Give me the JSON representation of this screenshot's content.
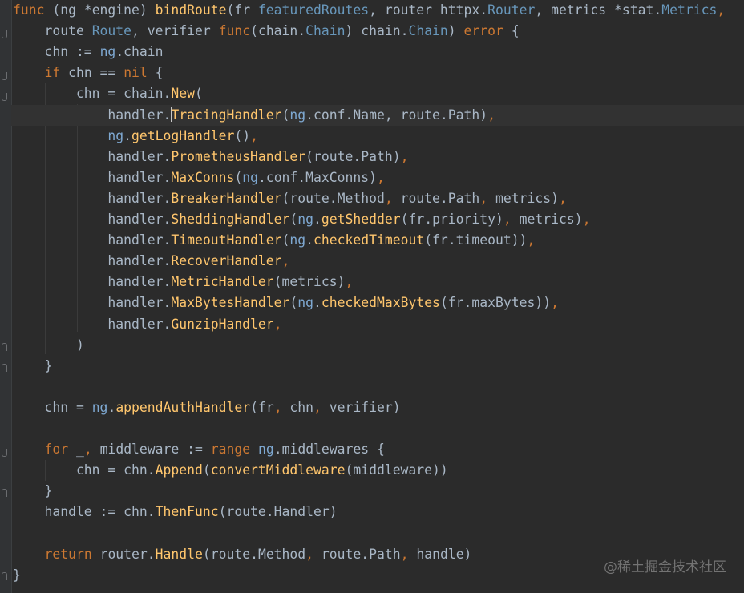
{
  "colors": {
    "background": "#2b2b2b",
    "keyword": "#cc7832",
    "default_text": "#a9b7c6",
    "function_call": "#ffc66d",
    "member_function": "#ffc66d",
    "type_name": "#6897bb",
    "receiver": "#7ea8d1",
    "package": "#a9b7c6",
    "field": "#9876aa",
    "comma": "#cc7832"
  },
  "icons": [
    "fold-open-icon",
    "fold-close-icon",
    "text-caret"
  ],
  "code_lines": [
    [
      [
        "func",
        "kw"
      ],
      [
        " (ng *engine) ",
        "t"
      ],
      [
        "bindRoute",
        "fn"
      ],
      [
        "(fr ",
        "t"
      ],
      [
        "featuredRoutes",
        "ty"
      ],
      [
        ", router ",
        "t"
      ],
      [
        "httpx",
        "t"
      ],
      [
        ".",
        "t"
      ],
      [
        "Router",
        "ty"
      ],
      [
        ", metrics *",
        "t"
      ],
      [
        "stat",
        "t"
      ],
      [
        ".",
        "t"
      ],
      [
        "Metrics",
        "ty"
      ],
      [
        ",",
        "kw"
      ]
    ],
    [
      [
        "    route ",
        "t"
      ],
      [
        "Route",
        "ty"
      ],
      [
        ", verifier ",
        "t"
      ],
      [
        "func",
        "kw"
      ],
      [
        "(chain.",
        "t"
      ],
      [
        "Chain",
        "ty"
      ],
      [
        ") chain.",
        "t"
      ],
      [
        "Chain",
        "ty"
      ],
      [
        ") ",
        "t"
      ],
      [
        "error",
        "kw"
      ],
      [
        " {",
        "t"
      ]
    ],
    [
      [
        "    chn := ",
        "t"
      ],
      [
        "ng",
        "rc"
      ],
      [
        ".chain",
        "t"
      ]
    ],
    [
      [
        "    ",
        "t"
      ],
      [
        "if",
        "kw"
      ],
      [
        " chn == ",
        "t"
      ],
      [
        "nil",
        "kw"
      ],
      [
        " {",
        "t"
      ]
    ],
    [
      [
        "        chn = chain.",
        "t"
      ],
      [
        "New",
        "mf"
      ],
      [
        "(",
        "t"
      ]
    ],
    [
      [
        "            handler.",
        "t"
      ],
      [
        "CARET",
        "caret"
      ],
      [
        "TracingHandler",
        "mf"
      ],
      [
        "(",
        "t"
      ],
      [
        "ng",
        "rc"
      ],
      [
        ".conf.Name, route.Path)",
        "t"
      ],
      [
        ",",
        "kw"
      ]
    ],
    [
      [
        "            ",
        "t"
      ],
      [
        "ng",
        "rc"
      ],
      [
        ".",
        "t"
      ],
      [
        "getLogHandler",
        "mf"
      ],
      [
        "()",
        "t"
      ],
      [
        ",",
        "kw"
      ]
    ],
    [
      [
        "            handler.",
        "t"
      ],
      [
        "PrometheusHandler",
        "mf"
      ],
      [
        "(route.Path)",
        "t"
      ],
      [
        ",",
        "kw"
      ]
    ],
    [
      [
        "            handler.",
        "t"
      ],
      [
        "MaxConns",
        "mf"
      ],
      [
        "(",
        "t"
      ],
      [
        "ng",
        "rc"
      ],
      [
        ".conf.MaxConns)",
        "t"
      ],
      [
        ",",
        "kw"
      ]
    ],
    [
      [
        "            handler.",
        "t"
      ],
      [
        "BreakerHandler",
        "mf"
      ],
      [
        "(route.Method",
        "t"
      ],
      [
        ",",
        "kw"
      ],
      [
        " route.Path",
        "t"
      ],
      [
        ",",
        "kw"
      ],
      [
        " metrics)",
        "t"
      ],
      [
        ",",
        "kw"
      ]
    ],
    [
      [
        "            handler.",
        "t"
      ],
      [
        "SheddingHandler",
        "mf"
      ],
      [
        "(",
        "t"
      ],
      [
        "ng",
        "rc"
      ],
      [
        ".",
        "t"
      ],
      [
        "getShedder",
        "mf"
      ],
      [
        "(fr.priority)",
        "t"
      ],
      [
        ",",
        "kw"
      ],
      [
        " metrics)",
        "t"
      ],
      [
        ",",
        "kw"
      ]
    ],
    [
      [
        "            handler.",
        "t"
      ],
      [
        "TimeoutHandler",
        "mf"
      ],
      [
        "(",
        "t"
      ],
      [
        "ng",
        "rc"
      ],
      [
        ".",
        "t"
      ],
      [
        "checkedTimeout",
        "mf"
      ],
      [
        "(fr.timeout))",
        "t"
      ],
      [
        ",",
        "kw"
      ]
    ],
    [
      [
        "            handler.",
        "t"
      ],
      [
        "RecoverHandler",
        "fn"
      ],
      [
        ",",
        "kw"
      ]
    ],
    [
      [
        "            handler.",
        "t"
      ],
      [
        "MetricHandler",
        "mf"
      ],
      [
        "(metrics)",
        "t"
      ],
      [
        ",",
        "kw"
      ]
    ],
    [
      [
        "            handler.",
        "t"
      ],
      [
        "MaxBytesHandler",
        "mf"
      ],
      [
        "(",
        "t"
      ],
      [
        "ng",
        "rc"
      ],
      [
        ".",
        "t"
      ],
      [
        "checkedMaxBytes",
        "mf"
      ],
      [
        "(fr.maxBytes))",
        "t"
      ],
      [
        ",",
        "kw"
      ]
    ],
    [
      [
        "            handler.",
        "t"
      ],
      [
        "GunzipHandler",
        "fn"
      ],
      [
        ",",
        "kw"
      ]
    ],
    [
      [
        "        )",
        "t"
      ]
    ],
    [
      [
        "    }",
        "t"
      ]
    ],
    [
      [
        "",
        "t"
      ]
    ],
    [
      [
        "    chn = ",
        "t"
      ],
      [
        "ng",
        "rc"
      ],
      [
        ".",
        "t"
      ],
      [
        "appendAuthHandler",
        "mf"
      ],
      [
        "(fr",
        "t"
      ],
      [
        ",",
        "kw"
      ],
      [
        " chn",
        "t"
      ],
      [
        ",",
        "kw"
      ],
      [
        " verifier)",
        "t"
      ]
    ],
    [
      [
        "",
        "t"
      ]
    ],
    [
      [
        "    ",
        "t"
      ],
      [
        "for",
        "kw"
      ],
      [
        " _",
        "t"
      ],
      [
        ",",
        "kw"
      ],
      [
        " middleware := ",
        "t"
      ],
      [
        "range",
        "kw"
      ],
      [
        " ",
        "t"
      ],
      [
        "ng",
        "rc"
      ],
      [
        ".middlewares {",
        "t"
      ]
    ],
    [
      [
        "        chn = chn.",
        "t"
      ],
      [
        "Append",
        "mf"
      ],
      [
        "(",
        "t"
      ],
      [
        "convertMiddleware",
        "mf"
      ],
      [
        "(middleware))",
        "t"
      ]
    ],
    [
      [
        "    }",
        "t"
      ]
    ],
    [
      [
        "    handle := chn.",
        "t"
      ],
      [
        "ThenFunc",
        "mf"
      ],
      [
        "(route.Handler)",
        "t"
      ]
    ],
    [
      [
        "",
        "t"
      ]
    ],
    [
      [
        "    ",
        "t"
      ],
      [
        "return",
        "kw"
      ],
      [
        " router.",
        "t"
      ],
      [
        "Handle",
        "mf"
      ],
      [
        "(route.Method",
        "t"
      ],
      [
        ",",
        "kw"
      ],
      [
        " route.Path",
        "t"
      ],
      [
        ",",
        "kw"
      ],
      [
        " handle)",
        "t"
      ]
    ],
    [
      [
        "}",
        "t"
      ]
    ]
  ],
  "watermark": "@稀土掘金技术社区"
}
